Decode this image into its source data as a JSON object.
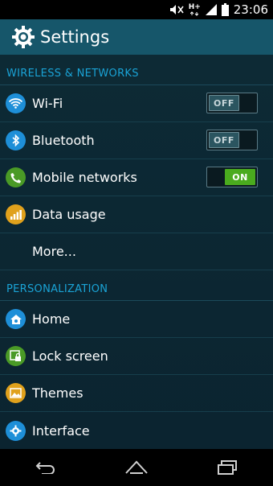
{
  "status_bar": {
    "time": "23:06",
    "icons": [
      "mute-icon",
      "hplus-icon",
      "signal-icon",
      "battery-icon"
    ],
    "network_type": "H+"
  },
  "app_bar": {
    "title": "Settings",
    "icon": "gear-icon"
  },
  "sections": [
    {
      "header": "WIRELESS & NETWORKS",
      "items": [
        {
          "label": "Wi-Fi",
          "icon": "wifi-icon",
          "icon_color": "#1e8fd8",
          "toggle": "OFF"
        },
        {
          "label": "Bluetooth",
          "icon": "bluetooth-icon",
          "icon_color": "#1e8fd8",
          "toggle": "OFF"
        },
        {
          "label": "Mobile networks",
          "icon": "phone-icon",
          "icon_color": "#4a9a26",
          "toggle": "ON"
        },
        {
          "label": "Data usage",
          "icon": "data-usage-icon",
          "icon_color": "#e0a11c"
        },
        {
          "label": "More..."
        }
      ]
    },
    {
      "header": "PERSONALIZATION",
      "items": [
        {
          "label": "Home",
          "icon": "home-icon",
          "icon_color": "#1e8fd8"
        },
        {
          "label": "Lock screen",
          "icon": "lock-screen-icon",
          "icon_color": "#4a9a26"
        },
        {
          "label": "Themes",
          "icon": "themes-icon",
          "icon_color": "#e0a11c"
        },
        {
          "label": "Interface",
          "icon": "interface-icon",
          "icon_color": "#1e8fd8"
        }
      ]
    }
  ],
  "nav_bar": {
    "buttons": [
      "back-icon",
      "home-nav-icon",
      "recents-icon"
    ]
  },
  "colors": {
    "app_bar": "#16566a",
    "background": "#0d2a35",
    "section_header": "#1aa3d6",
    "toggle_on": "#4aab1e"
  }
}
